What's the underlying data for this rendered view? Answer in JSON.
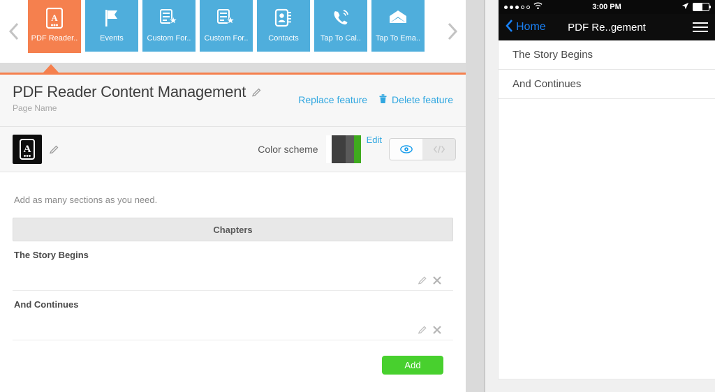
{
  "tabstrip": {
    "prev_arrow": "chevron-left",
    "next_arrow": "chevron-right",
    "tabs": [
      {
        "label": "PDF Reader..",
        "icon": "pdf-reader-icon",
        "active": true
      },
      {
        "label": "Events",
        "icon": "flag-icon",
        "active": false
      },
      {
        "label": "Custom For..",
        "icon": "custom-form-icon",
        "active": false
      },
      {
        "label": "Custom For..",
        "icon": "custom-form-icon",
        "active": false
      },
      {
        "label": "Contacts",
        "icon": "contacts-icon",
        "active": false
      },
      {
        "label": "Tap To Cal..",
        "icon": "phone-icon",
        "active": false
      },
      {
        "label": "Tap To Ema..",
        "icon": "envelope-icon",
        "active": false
      }
    ]
  },
  "header": {
    "title": "PDF Reader Content Management",
    "subtitle": "Page Name",
    "edit_title_icon": "pencil-icon",
    "replace_feature": "Replace feature",
    "delete_feature": "Delete feature",
    "trash_icon": "trash-icon"
  },
  "scheme": {
    "feature_icon": "pdf-reader-icon",
    "edit_icon": "pencil-icon",
    "label": "Color scheme",
    "edit_link": "Edit",
    "colors": [
      "#ffffff",
      "#3f3f3f",
      "#5a5a5a",
      "#3faa1e"
    ],
    "toggle": {
      "preview_icon": "eye-icon",
      "code_icon": "code-icon",
      "active": "preview"
    }
  },
  "content": {
    "hint": "Add as many sections as you need.",
    "section_header": "Chapters",
    "rows": [
      {
        "title": "The Story Begins",
        "edit_icon": "pencil-icon",
        "delete_icon": "close-icon"
      },
      {
        "title": "And Continues",
        "edit_icon": "pencil-icon",
        "delete_icon": "close-icon"
      }
    ],
    "add_button": "Add",
    "add_button_color": "#48d02e"
  },
  "preview": {
    "status": {
      "signal_filled": 3,
      "signal_empty": 2,
      "wifi_icon": "wifi-icon",
      "time": "3:00 PM",
      "location_icon": "location-arrow-icon",
      "battery_icon": "battery-icon",
      "battery_level": 60
    },
    "navbar": {
      "back_icon": "chevron-left-icon",
      "back_label": "Home",
      "title": "PDF Re..gement",
      "menu_icon": "hamburger-icon"
    },
    "list": [
      {
        "label": "The Story Begins"
      },
      {
        "label": "And Continues"
      }
    ]
  }
}
